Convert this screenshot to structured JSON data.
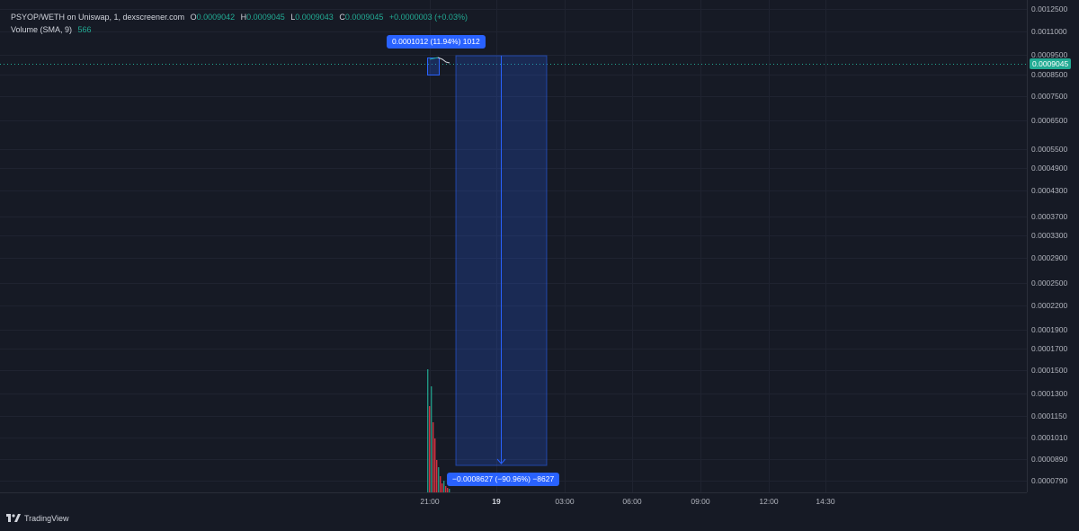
{
  "legend": {
    "symbol": "PSYOP/WETH on Uniswap, 1, dexscreener.com",
    "open_label": "O",
    "open_value": "0.0009042",
    "high_label": "H",
    "high_value": "0.0009045",
    "low_label": "L",
    "low_value": "0.0009043",
    "close_label": "C",
    "close_value": "0.0009045",
    "change": "+0.0000003 (+0.03%)",
    "volume_label": "Volume (SMA, 9)",
    "volume_value": "566"
  },
  "price_axis": {
    "ticks": [
      "0.0012500",
      "0.0011000",
      "0.0009500",
      "0.0008500",
      "0.0007500",
      "0.0006500",
      "0.0005500",
      "0.0004900",
      "0.0004300",
      "0.0003700",
      "0.0003300",
      "0.0002900",
      "0.0002500",
      "0.0002200",
      "0.0001900",
      "0.0001700",
      "0.0001500",
      "0.0001300",
      "0.0001150",
      "0.0001010",
      "0.0000890",
      "0.0000790"
    ],
    "current_price": "0.0009045"
  },
  "time_axis": {
    "ticks": [
      "21:00",
      "19",
      "03:00",
      "06:00",
      "09:00",
      "12:00",
      "14:30"
    ],
    "bold_tick": "19"
  },
  "measure_tool": {
    "top_label": "0.0001012 (11.94%) 1012",
    "bottom_label": "−0.0008627 (−90.96%) −8627"
  },
  "branding": {
    "name": "TradingView"
  },
  "colors": {
    "background": "#161a25",
    "grid": "#1f2330",
    "up": "#22ab94",
    "down": "#f23645",
    "measure": "#2962ff",
    "text": "#d1d4dc"
  },
  "chart_data": {
    "type": "candlestick",
    "log_scale": true,
    "grid": true,
    "ylim": [
      7.5e-05,
      0.00125
    ],
    "current_price": 0.0009045,
    "measure_range": {
      "start_price": 0.0009485,
      "end_price": 8.58e-05,
      "change_abs": -0.0008627,
      "change_pct": -90.96
    }
  }
}
